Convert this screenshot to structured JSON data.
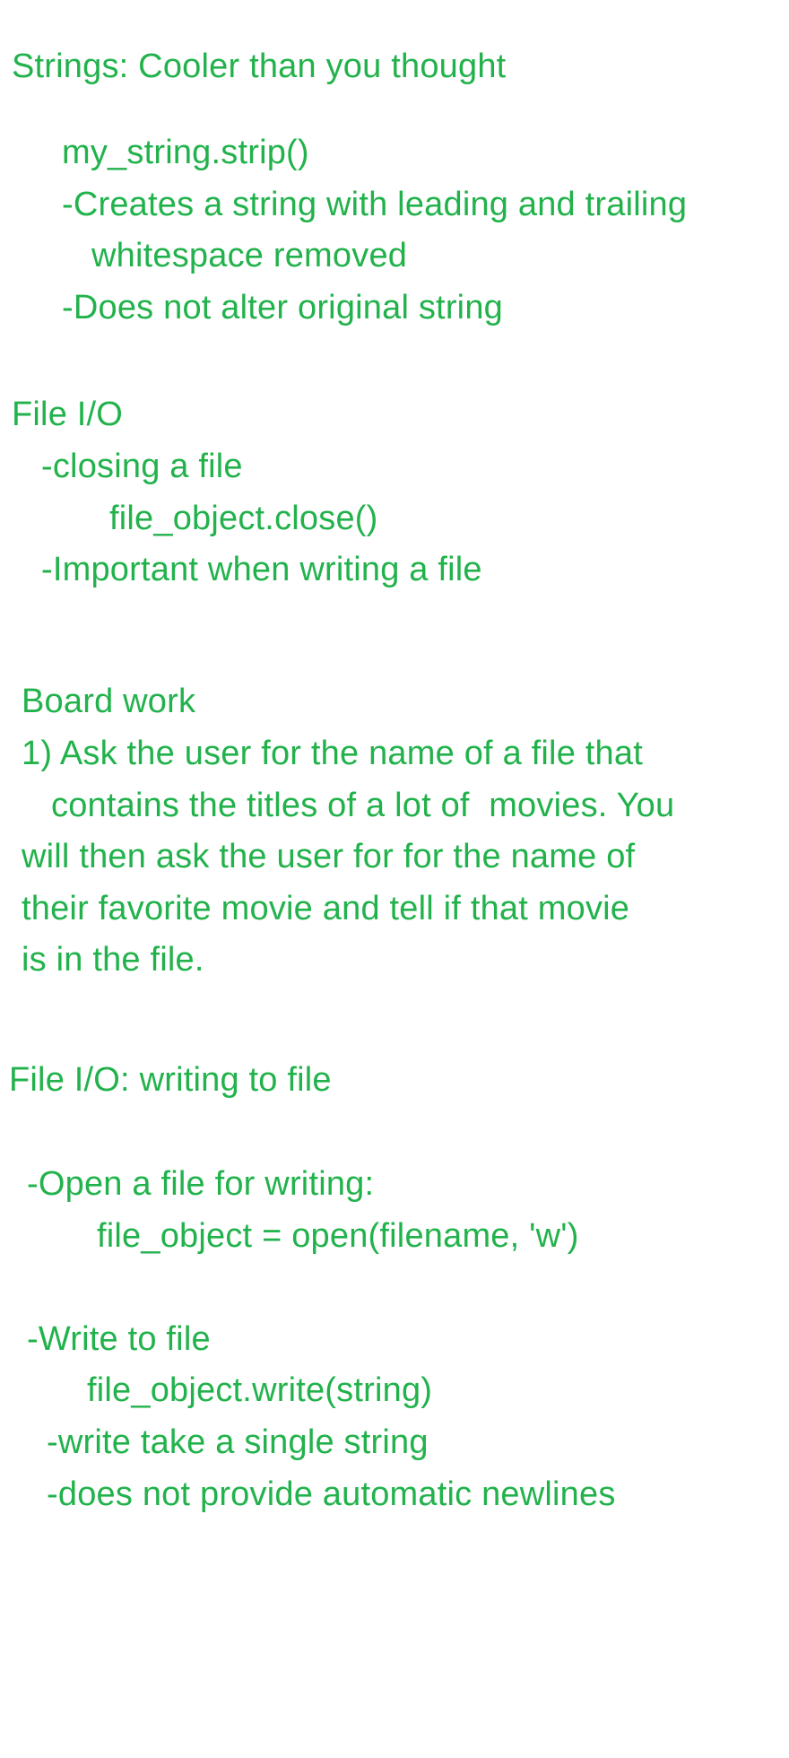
{
  "text_color": "#22b24c",
  "background_color": "#ffffff",
  "sections": [
    {
      "heading": "Strings: Cooler than you thought",
      "lines": [
        "my_string.strip()",
        "-Creates a string with leading and trailing",
        "whitespace removed",
        "-Does not alter original string"
      ]
    },
    {
      "heading": "File I/O",
      "lines": [
        "-closing a file",
        "file_object.close()",
        "-Important when writing a file"
      ]
    },
    {
      "heading": "Board work",
      "lines": [
        "1) Ask the user for the name of a file that",
        "contains the titles of a lot of  movies. You",
        "will then ask the user for for the name of",
        "their favorite movie and tell if that movie",
        "is in the file."
      ]
    },
    {
      "heading": "File I/O: writing to file",
      "lines": [
        "-Open a file for writing:",
        "file_object = open(filename, 'w')",
        "-Write to file",
        "file_object.write(string)",
        "-write take a single string",
        "-does not provide automatic newlines"
      ]
    }
  ]
}
